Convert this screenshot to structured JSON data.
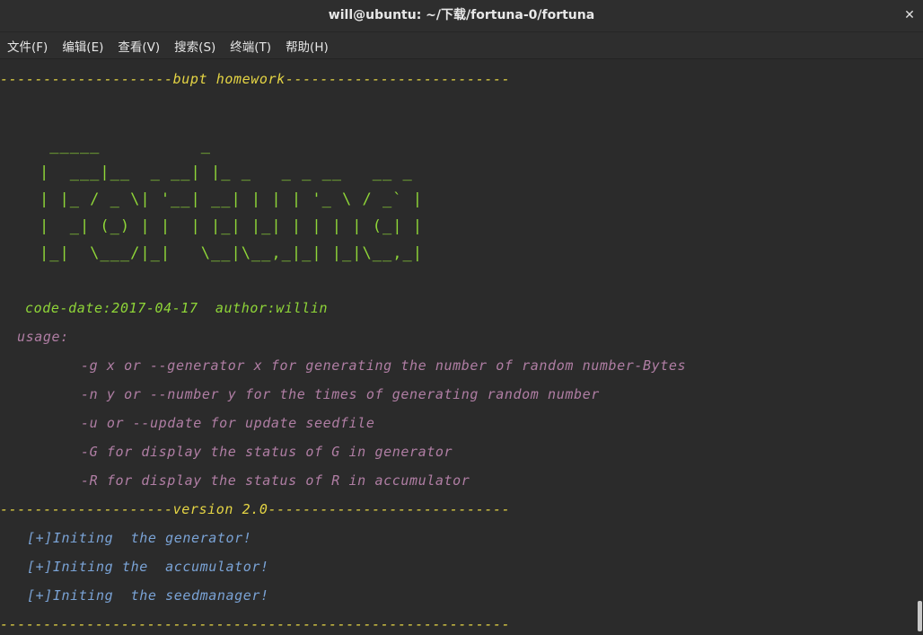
{
  "window": {
    "title": "will@ubuntu: ~/下载/fortuna-0/fortuna",
    "close_glyph": "✕"
  },
  "menubar": {
    "items": [
      {
        "label": "文件(F)"
      },
      {
        "label": "编辑(E)"
      },
      {
        "label": "查看(V)"
      },
      {
        "label": "搜索(S)"
      },
      {
        "label": "终端(T)"
      },
      {
        "label": "帮助(H)"
      }
    ]
  },
  "terminal": {
    "header_line": "--------------------bupt homework--------------------------",
    "ascii_art": " _____          _\n|  ___|__  _ __| |_ _   _ _ __   __ _\n| |_ / _ \\| '__| __| | | | '_ \\ / _` |\n|  _| (_) | |  | |_| |_| | | | | (_| |\n|_|  \\___/|_|   \\__|\\__,_|_| |_|\\__,_|",
    "code_info": "code-date:2017-04-17  author:willin",
    "usage_label": "usage:",
    "usage_lines": [
      "-g x or --generator x for generating the number of random number-Bytes",
      "-n y or --number y for the times of generating random number",
      "-u or --update for update seedfile",
      "-G for display the status of G in generator",
      "-R for display the status of R in accumulator"
    ],
    "version_line": "--------------------version 2.0----------------------------",
    "init_lines": [
      "[+]Initing  the generator!",
      "[+]Initing the  accumulator!",
      "[+]Initing  the seedmanager!"
    ],
    "footer_line": "-----------------------------------------------------------"
  },
  "colors": {
    "background": "#2b2b2b",
    "yellow": "#e5d544",
    "green": "#8fd638",
    "purple": "#b07ea4",
    "blue": "#7aa3d6"
  }
}
